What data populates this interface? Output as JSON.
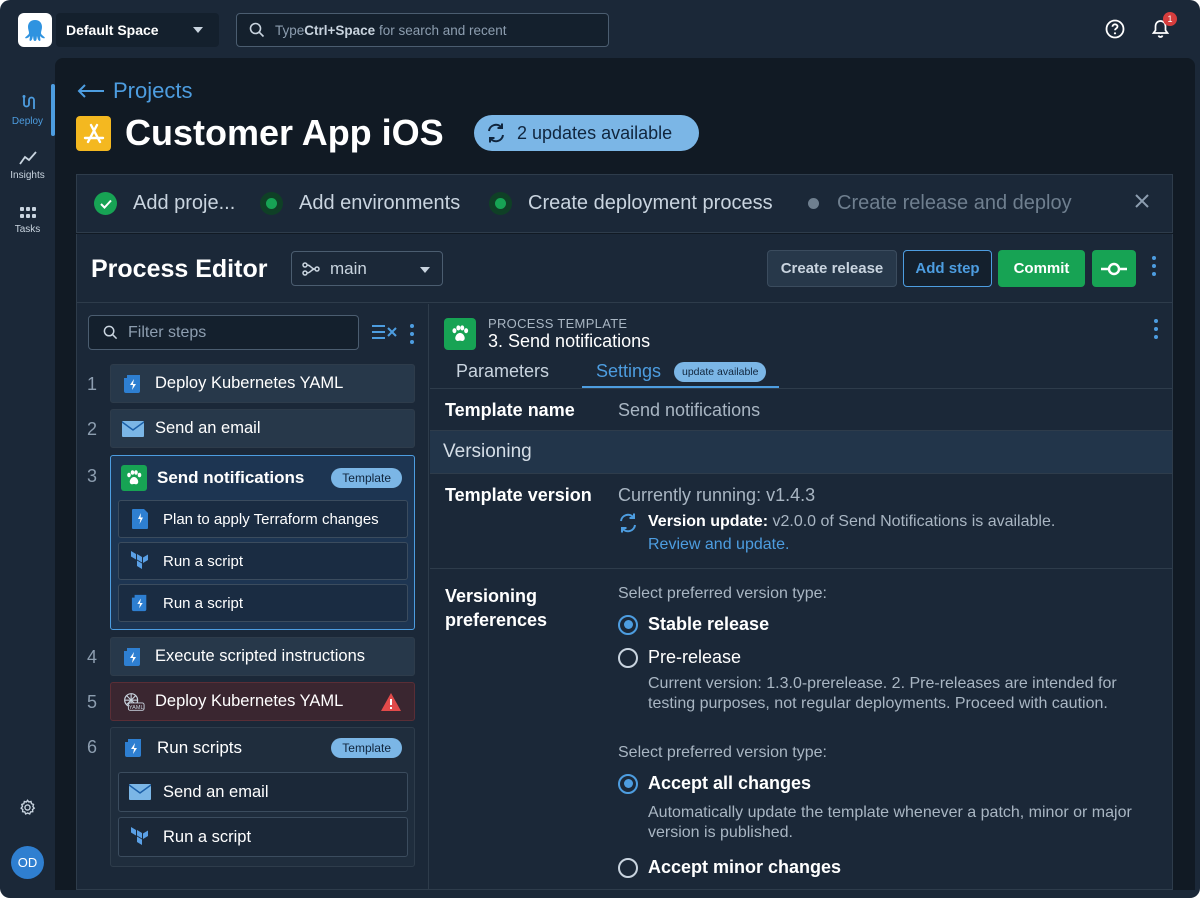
{
  "topbar": {
    "space_name": "Default Space",
    "search_pre": "Type ",
    "search_key": "Ctrl+Space",
    "search_post": " for search and recent",
    "notification_count": "1"
  },
  "sidebar": {
    "items": [
      {
        "label": "Deploy",
        "icon": "deploy-icon",
        "active": true
      },
      {
        "label": "Insights",
        "icon": "insights-icon"
      },
      {
        "label": "Tasks",
        "icon": "tasks-icon"
      }
    ],
    "avatar_initials": "OD"
  },
  "header": {
    "back_label": "Projects",
    "project_title": "Customer App iOS",
    "updates_label": "2 updates available"
  },
  "stepper": {
    "steps": [
      {
        "label": "Add proje...",
        "status": "complete"
      },
      {
        "label": "Add environments",
        "status": "complete"
      },
      {
        "label": "Create deployment process",
        "status": "complete"
      },
      {
        "label": "Create release and deploy",
        "status": "pending"
      }
    ]
  },
  "editor": {
    "title": "Process Editor",
    "branch": "main",
    "buttons": {
      "create_release": "Create release",
      "add_step": "Add step",
      "commit": "Commit"
    },
    "filter_placeholder": "Filter steps"
  },
  "steps": [
    {
      "num": "1",
      "label": "Deploy Kubernetes YAML"
    },
    {
      "num": "2",
      "label": "Send an email"
    },
    {
      "num": "3",
      "label": "Send notifications",
      "badge": "Template",
      "children": [
        {
          "label": "Plan to apply Terraform changes"
        },
        {
          "label": "Run a script"
        },
        {
          "label": "Run a script"
        }
      ]
    },
    {
      "num": "4",
      "label": "Execute scripted instructions"
    },
    {
      "num": "5",
      "label": "Deploy Kubernetes YAML",
      "warning": true
    },
    {
      "num": "6",
      "label": "Run scripts",
      "badge": "Template",
      "children": [
        {
          "label": "Send an email"
        },
        {
          "label": "Run a script"
        }
      ]
    }
  ],
  "detail": {
    "kicker": "PROCESS TEMPLATE",
    "name": "3. Send notifications",
    "tabs": {
      "parameters": "Parameters",
      "settings": "Settings",
      "settings_badge": "update available"
    },
    "template_name_label": "Template name",
    "template_name_value": "Send notifications",
    "versioning_header": "Versioning",
    "template_version_label": "Template version",
    "currently_running": "Currently running: v1.4.3",
    "version_update_bold": "Version update:",
    "version_update_text": " v2.0.0 of Send Notifications is available.",
    "review_link": "Review and update.",
    "pref_label_1": "Versioning",
    "pref_label_2": "preferences",
    "select_type_1": "Select preferred version type:",
    "stable": "Stable release",
    "prerelease": "Pre-release",
    "prerelease_help": "Current version: 1.3.0-prerelease. 2. Pre-releases are intended for testing purposes, not regular deployments. Proceed with caution.",
    "select_type_2": "Select preferred version type:",
    "accept_all": "Accept all changes",
    "accept_all_help": "Automatically update the template whenever a patch, minor or major version is published.",
    "accept_minor": "Accept minor changes"
  }
}
